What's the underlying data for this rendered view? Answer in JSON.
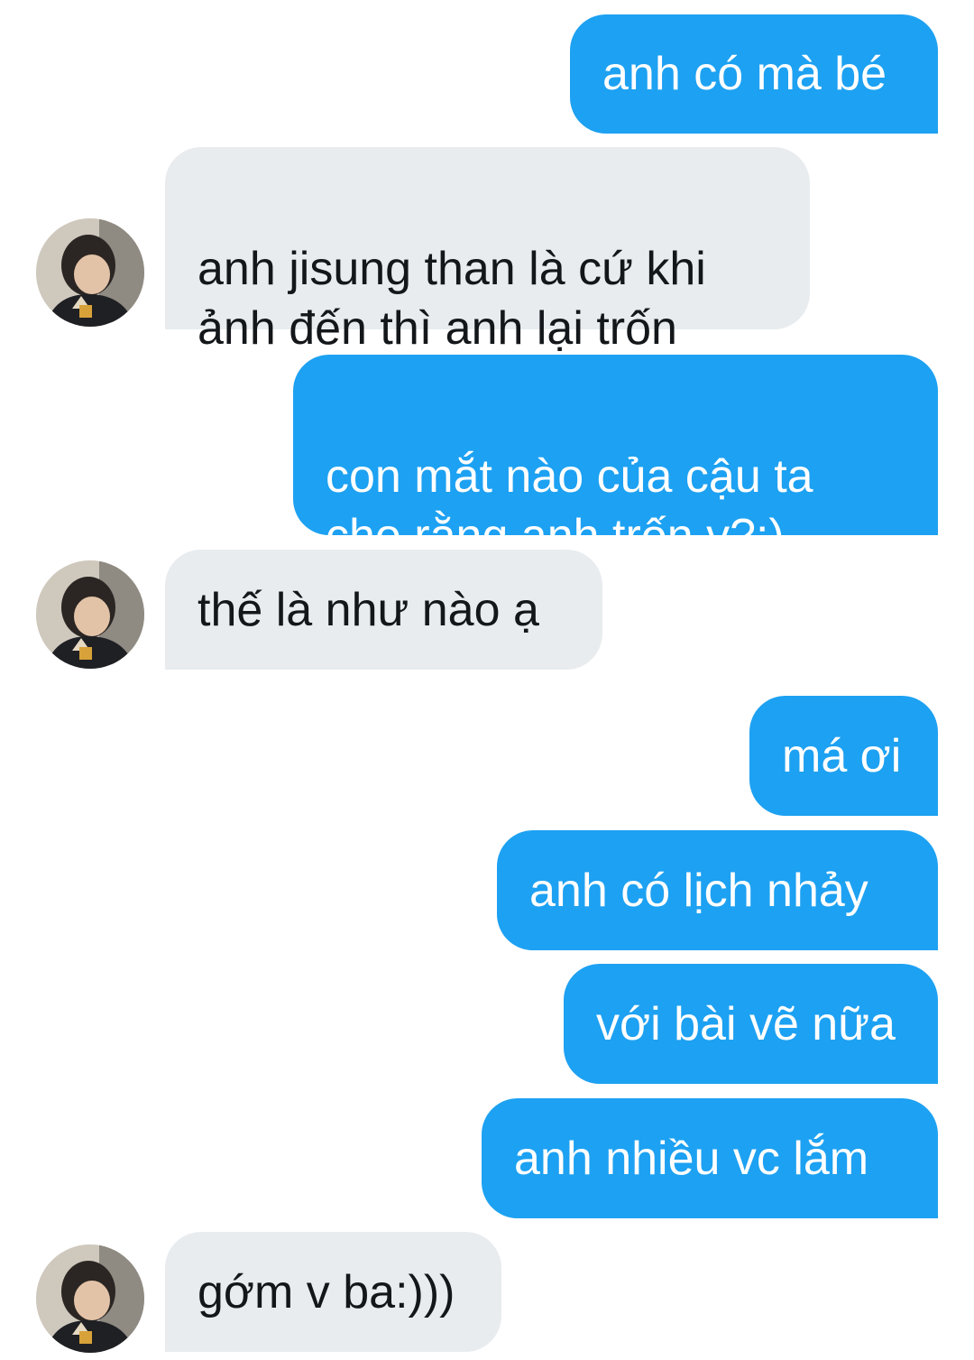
{
  "messages": [
    {
      "side": "out",
      "text": "anh có mà bé"
    },
    {
      "side": "in",
      "text": "anh jisung than là cứ khi\nảnh đến thì anh lại trốn"
    },
    {
      "side": "out",
      "text": "con mắt nào của cậu ta\ncho rằng anh trốn v?:)"
    },
    {
      "side": "in",
      "text": "thế là như nào ạ"
    },
    {
      "side": "out",
      "text": "má ơi"
    },
    {
      "side": "out",
      "text": "anh có lịch nhảy"
    },
    {
      "side": "out",
      "text": "với bài vẽ nữa"
    },
    {
      "side": "out",
      "text": "anh nhiều vc lắm"
    },
    {
      "side": "in",
      "text": "gớm v ba:)))"
    }
  ],
  "colors": {
    "outgoing_bubble": "#1da1f2",
    "incoming_bubble": "#e8ecef",
    "outgoing_text": "#ffffff",
    "incoming_text": "#14171a"
  },
  "icons": {
    "avatar": "contact-avatar-photo"
  }
}
